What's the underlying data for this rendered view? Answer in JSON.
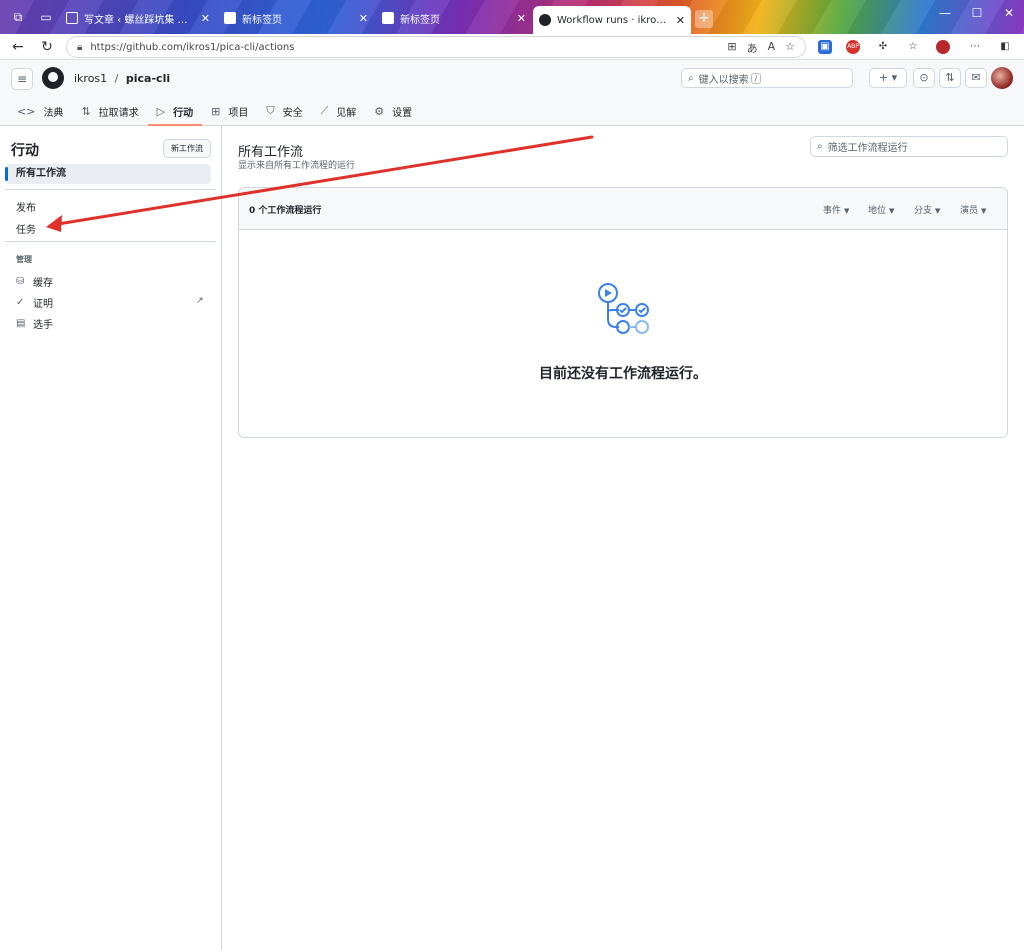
{
  "browser": {
    "tabs": [
      {
        "title": "写文章 ‹ 螺丝踩坑集 — WordPress",
        "active": false
      },
      {
        "title": "新标签页",
        "active": false
      },
      {
        "title": "新标签页",
        "active": false
      },
      {
        "title": "Workflow runs · ikros1/pica-cli",
        "active": true
      }
    ],
    "new_tab": "+",
    "url": "https://github.com/ikros1/pica-cli/actions",
    "window_controls": [
      "—",
      "☐",
      "✕"
    ]
  },
  "github": {
    "owner": "ikros1",
    "separator": "/",
    "repo": "pica-cli",
    "search_placeholder": "键入以搜索",
    "search_key": "/",
    "nav": [
      {
        "icon": "code-icon",
        "label": "法典"
      },
      {
        "icon": "pull-request-icon",
        "label": "拉取请求"
      },
      {
        "icon": "play-icon",
        "label": "行动"
      },
      {
        "icon": "table-icon",
        "label": "项目"
      },
      {
        "icon": "shield-icon",
        "label": "安全"
      },
      {
        "icon": "graph-icon",
        "label": "见解"
      },
      {
        "icon": "gear-icon",
        "label": "设置"
      }
    ]
  },
  "sidebar": {
    "title": "行动",
    "new_button": "新工作流",
    "all_workflows": "所有工作流",
    "items": [
      "发布",
      "任务"
    ],
    "manage_heading": "管理",
    "manage_items": [
      {
        "icon": "database-icon",
        "label": "缓存"
      },
      {
        "icon": "check-circle-icon",
        "label": "证明"
      },
      {
        "icon": "server-icon",
        "label": "选手"
      }
    ]
  },
  "main": {
    "title": "所有工作流",
    "subtitle": "显示来自所有工作流程的运行",
    "filter_placeholder": "筛选工作流程运行",
    "runs_count": "0 个工作流程运行",
    "filters": [
      "事件",
      "地位",
      "分支",
      "演员"
    ],
    "empty_message": "目前还没有工作流程运行。"
  },
  "colors": {
    "accent": "#0969da",
    "nav_underline": "#fd8c73",
    "annotation_arrow": "#e0302a"
  }
}
